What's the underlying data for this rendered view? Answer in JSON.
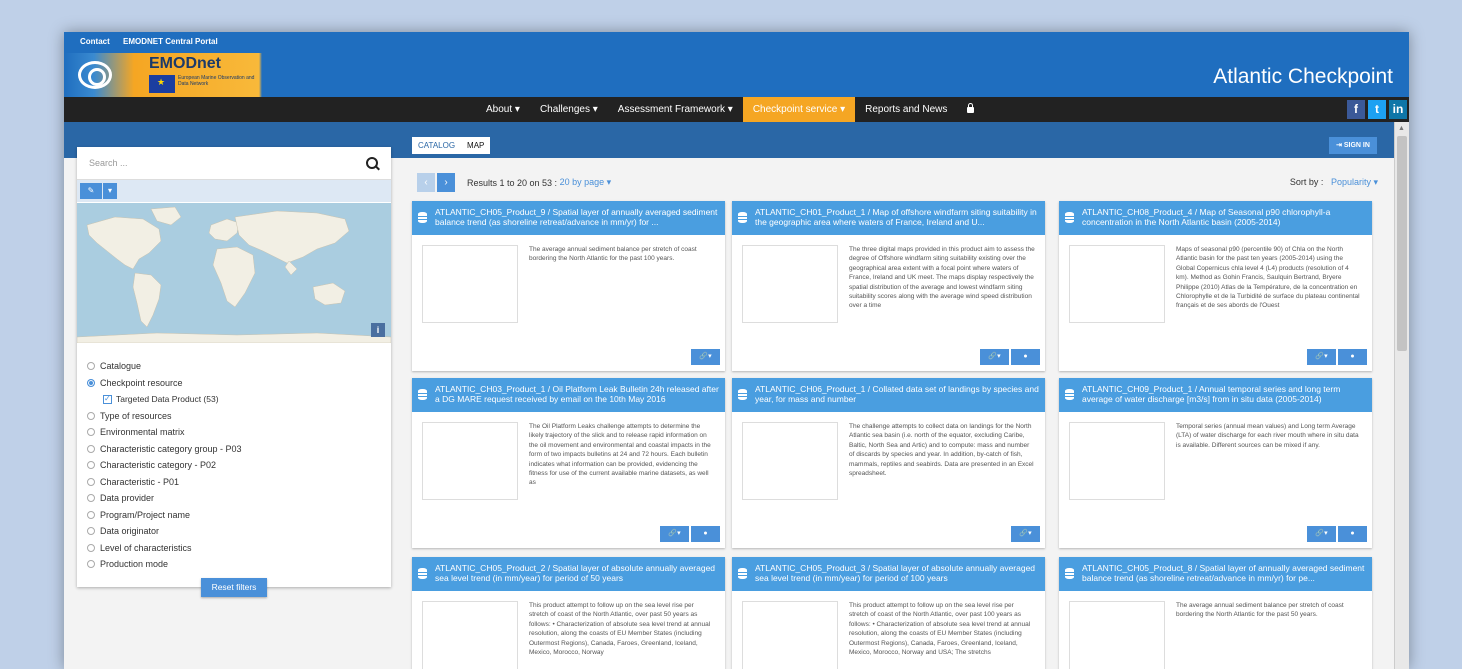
{
  "top_links": [
    "Contact",
    "EMODNET Central Portal"
  ],
  "logo": {
    "name": "EMODnet",
    "subtitle": "European Marine Observation and Data Network"
  },
  "site_title": "Atlantic Checkpoint",
  "nav": [
    {
      "label": "About ▾"
    },
    {
      "label": "Challenges ▾"
    },
    {
      "label": "Assessment Framework ▾"
    },
    {
      "label": "Checkpoint service ▾",
      "active": true
    },
    {
      "label": "Reports and News"
    }
  ],
  "social": [
    "f",
    "t",
    "in"
  ],
  "tabs": [
    "CATALOG",
    "MAP"
  ],
  "signin_label": "SIGN IN",
  "search": {
    "placeholder": "Search ..."
  },
  "facets": {
    "items": [
      "Catalogue",
      "Checkpoint resource",
      "Targeted Data Product (53)",
      "Type of resources",
      "Environmental matrix",
      "Characteristic category group - P03",
      "Characteristic category - P02",
      "Characteristic - P01",
      "Data provider",
      "Program/Project name",
      "Data originator",
      "Level of characteristics",
      "Production mode"
    ],
    "reset_label": "Reset filters"
  },
  "results": {
    "prefix": "Results 1 to 20 on 53 :",
    "per_page": "20 by page ▾",
    "sort_label": "Sort by :",
    "sort_value": "Popularity ▾"
  },
  "cards": [
    {
      "title": "ATLANTIC_CH05_Product_9 / Spatial layer of annually averaged sediment balance trend (as shoreline retreat/advance in mm/yr) for ...",
      "desc": "The average annual sediment balance per stretch of coast bordering the North Atlantic for the past 100 years.",
      "actions": [
        "link"
      ]
    },
    {
      "title": "ATLANTIC_CH01_Product_1 / Map of offshore windfarm siting suitability in the geographic area where waters of France, Ireland and U...",
      "desc": "The three digital maps provided in this product aim to assess the degree of Offshore windfarm siting suitability existing over the geographical area extent with a focal point where waters of France, Ireland and UK meet. The maps display respectively the spatial distribution of the average and lowest windfarm siting suitability scores along with the average wind speed distribution over a time",
      "actions": [
        "link",
        "globe"
      ]
    },
    {
      "title": "ATLANTIC_CH08_Product_4 / Map of Seasonal p90 chlorophyll-a concentration in the North Atlantic basin (2005-2014)",
      "desc": "Maps of seasonal p90 (percentile 90) of Chla on the North Atlantic basin for the past ten years (2005-2014) using the Global Copernicus chla level 4 (L4) products (resolution of 4 km). Method as Gohin Francis, Saulquin Bertrand, Bryere Philippe (2010) Atlas de la Température, de la concentration en Chlorophylle et de la Turbidité de surface du plateau continental français et de ses abords de l'Ouest",
      "actions": [
        "link",
        "globe"
      ]
    },
    {
      "title": "ATLANTIC_CH03_Product_1 / Oil Platform Leak Bulletin 24h released after a DG MARE request received by email on the 10th May 2016",
      "desc": "The Oil Platform Leaks challenge attempts to determine the likely trajectory of the slick and to release rapid information on the oil movement and environmental and coastal impacts in the form of two impacts bulletins at 24 and 72 hours. Each bulletin indicates what information can be provided, evidencing the fitness for use of the current available marine datasets, as well as",
      "actions": [
        "link",
        "globe"
      ]
    },
    {
      "title": "ATLANTIC_CH06_Product_1 / Collated data set of landings by species and year, for mass and number",
      "desc": "The challenge attempts to collect data on landings for the North Atlantic sea basin (i.e. north of the equator, excluding Caribe, Baltic, North Sea and Artic) and to compute: mass and number of discards by species and year. In addition, by-catch of fish, mammals, reptiles and seabirds. Data are presented in an Excel spreadsheet.",
      "actions": [
        "link"
      ]
    },
    {
      "title": "ATLANTIC_CH09_Product_1 / Annual temporal series and long term average of water discharge [m3/s] from in situ data (2005-2014)",
      "desc": "Temporal series (annual mean values) and Long term Average (LTA) of water discharge for each river mouth where in situ data is available. Different sources can be mixed if any.",
      "actions": [
        "link",
        "globe"
      ]
    },
    {
      "title": "ATLANTIC_CH05_Product_2 / Spatial layer of absolute annually averaged sea level trend (in mm/year) for period of 50 years",
      "desc": "This product attempt to follow up on the sea level rise per stretch of coast of the North Atlantic, over past 50 years as follows: • Characterization of absolute sea level trend at annual resolution, along the coasts of EU Member States (including Outermost Regions), Canada, Faroes, Greenland, Iceland, Mexico, Morocco, Norway",
      "actions": []
    },
    {
      "title": "ATLANTIC_CH05_Product_3 / Spatial layer of absolute annually averaged sea level trend (in mm/year) for period of 100 years",
      "desc": "This product attempt to follow up on the sea level rise per stretch of coast of the North Atlantic, over past 100 years as follows: • Characterization of absolute sea level trend at annual resolution, along the coasts of EU Member States (including Outermost Regions), Canada, Faroes, Greenland, Iceland, Mexico, Morocco, Norway and USA; The stretchs",
      "actions": []
    },
    {
      "title": "ATLANTIC_CH05_Product_8 / Spatial layer of annually averaged sediment balance trend (as shoreline retreat/advance in mm/yr) for pe...",
      "desc": "The average annual sediment balance per stretch of coast bordering the North Atlantic for the past 50 years.",
      "actions": []
    }
  ]
}
